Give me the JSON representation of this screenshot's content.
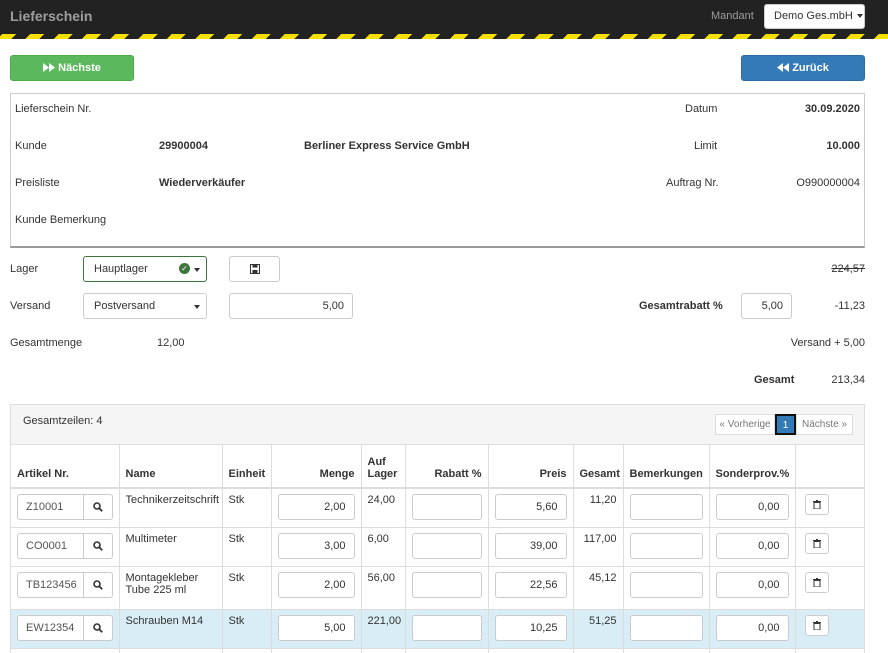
{
  "header": {
    "title": "Lieferschein",
    "mandant_label": "Mandant",
    "mandant_value": "Demo Ges.mbH"
  },
  "actions": {
    "next": "Nächste",
    "back": "Zurück"
  },
  "info": {
    "lieferschein_label": "Lieferschein Nr.",
    "datum_label": "Datum",
    "datum": "30.09.2020",
    "kunde_label": "Kunde",
    "kunde_nr": "29900004",
    "kunde_name": "Berliner Express Service GmbH",
    "limit_label": "Limit",
    "limit": "10.000",
    "preisliste_label": "Preisliste",
    "preisliste": "Wiederverkäufer",
    "auftrag_label": "Auftrag Nr.",
    "auftrag": "O990000004",
    "bemerkung_label": "Kunde Bemerkung"
  },
  "form": {
    "lager_label": "Lager",
    "lager_value": "Hauptlager",
    "versand_label": "Versand",
    "versand_value": "Postversand",
    "versand_cost": "5,00",
    "gesamtmenge_label": "Gesamtmenge",
    "gesamtmenge": "12,00",
    "gesamtrabatt_label": "Gesamtrabatt %",
    "gesamtrabatt": "5,00"
  },
  "totals": {
    "subtotal": "224,57",
    "rabatt": "-11,23",
    "versand": "Versand + 5,00",
    "gesamt_label": "Gesamt",
    "gesamt": "213,34"
  },
  "table": {
    "count_label": "Gesamtzeilen: 4",
    "pagination": {
      "prev": "« Vorherige",
      "page": "1",
      "next": "Nächste »"
    },
    "headers": {
      "artikel": "Artikel Nr.",
      "name": "Name",
      "einheit": "Einheit",
      "menge": "Menge",
      "auf": "Auf",
      "lager": "Lager",
      "rabatt": "Rabatt %",
      "preis": "Preis",
      "gesamt": "Gesamt",
      "bemerkungen": "Bemerkungen",
      "sonderprov": "Sonderprov.%"
    },
    "rows": [
      {
        "artikel": "Z10001",
        "name": "Technikerzeitschrift",
        "einheit": "Stk",
        "menge": "2,00",
        "lager": "24,00",
        "rabatt": "",
        "preis": "5,60",
        "gesamt": "11,20",
        "bemerkung": "",
        "sonderprov": "0,00"
      },
      {
        "artikel": "CO0001",
        "name": "Multimeter",
        "einheit": "Stk",
        "menge": "3,00",
        "lager": "6,00",
        "rabatt": "",
        "preis": "39,00",
        "gesamt": "117,00",
        "bemerkung": "",
        "sonderprov": "0,00"
      },
      {
        "artikel": "TB123456",
        "name": "Montagekleber Tube 225 ml",
        "einheit": "Stk",
        "menge": "2,00",
        "lager": "56,00",
        "rabatt": "",
        "preis": "22,56",
        "gesamt": "45,12",
        "bemerkung": "",
        "sonderprov": "0,00"
      },
      {
        "artikel": "EW12354",
        "name": "Schrauben M14",
        "einheit": "Stk",
        "menge": "5,00",
        "lager": "221,00",
        "rabatt": "",
        "preis": "10,25",
        "gesamt": "51,25",
        "bemerkung": "",
        "sonderprov": "0,00"
      }
    ]
  }
}
